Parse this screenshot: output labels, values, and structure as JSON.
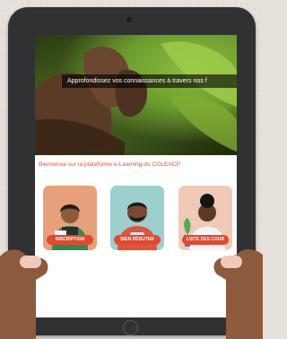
{
  "hero": {
    "caption": "Approfondissez vos connaissances à travers nos f"
  },
  "welcome_text": "Bienvenue sur la plateforme e-Learning du COLEACP",
  "cards": [
    {
      "label": "INSCRIPTION",
      "icon": "woman-with-document-icon"
    },
    {
      "label": "BIEN DÉBUTER",
      "icon": "man-with-tablet-icon"
    },
    {
      "label": "LISTE DES COUR",
      "icon": "woman-with-plant-icon"
    }
  ],
  "colors": {
    "accent": "#e0492f",
    "welcome": "#e2503b",
    "tablet_frame": "#2f3133",
    "skin": "#8c5a3c"
  }
}
